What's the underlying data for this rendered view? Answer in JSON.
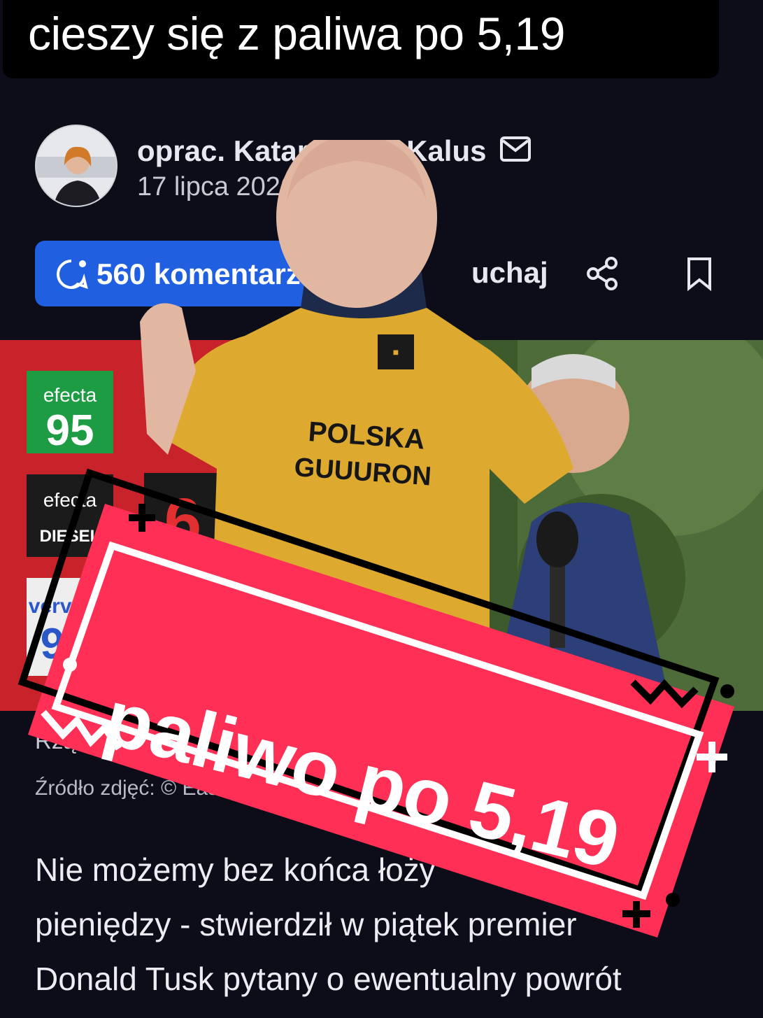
{
  "caption": {
    "text": "cieszy się z paliwa po 5,19"
  },
  "author": {
    "name_visible": "oprac. Katar",
    "name_end": "Kalus",
    "date": "17 lipca 2026"
  },
  "actions": {
    "comments": "560 komentarz",
    "listen": "uchaj"
  },
  "photo": {
    "signs": [
      {
        "brand": "efecta",
        "value": "95",
        "color": "#1e9c43"
      },
      {
        "brand": "efecta",
        "value": "DIESEL",
        "color": "#1b1b1b"
      },
      {
        "brand": "verva",
        "value": "9",
        "color": "#2a58c8"
      }
    ],
    "price_digit": "6.",
    "shirt_line1": "POLSKA",
    "shirt_line2": "GUUURON"
  },
  "image_caption": "Rząd",
  "image_source": "Źródło zdjęć: © Eas",
  "body": [
    "Nie możemy bez końca łoży",
    "pieniędzy - stwierdził w piątek premier",
    "Donald Tusk pytany o ewentualny powrót"
  ],
  "sticker": {
    "text": "paliwo po 5,19",
    "color": "#ff2f55"
  },
  "icons": [
    "mail-icon",
    "comment-icon",
    "share-icon",
    "bookmark-icon"
  ]
}
